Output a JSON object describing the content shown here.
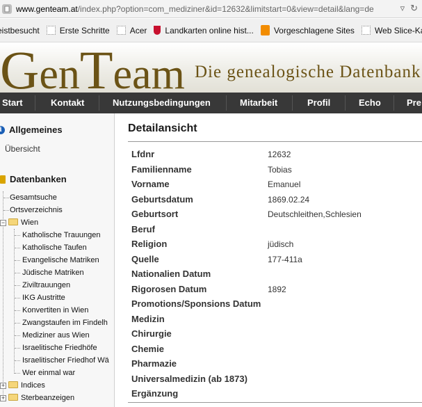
{
  "browser": {
    "url_host": "www.genteam.at",
    "url_rest": "/index.php?option=com_mediziner&id=12632&limitstart=0&view=detail&lang=de",
    "bookmarks": [
      "eistbesucht",
      "Erste Schritte",
      "Acer",
      "Landkarten online hist...",
      "Vorgeschlagene Sites",
      "Web Slice-Kata"
    ]
  },
  "banner": {
    "logo_g": "G",
    "logo_en": "en",
    "logo_t": "T",
    "logo_eam": "eam",
    "tagline": "Die genealogische Datenbank"
  },
  "nav": [
    "Start",
    "Kontakt",
    "Nutzungsbedingungen",
    "Mitarbeit",
    "Profil",
    "Echo",
    "Pre"
  ],
  "sidebar": {
    "allgemeines": "Allgemeines",
    "uebersicht": "Übersicht",
    "datenbanken": "Datenbanken",
    "tree": {
      "gesamtsuche": "Gesamtsuche",
      "ortsverzeichnis": "Ortsverzeichnis",
      "wien": "Wien",
      "wien_children": [
        "Katholische Trauungen",
        "Katholische Taufen",
        "Evangelische Matriken",
        "Jüdische Matriken",
        "Ziviltrauungen",
        "IKG Austritte",
        "Konvertiten in Wien",
        "Zwangstaufen im Findelh",
        "Mediziner aus Wien",
        "Israelitische Friedhöfe",
        "Israelitischer Friedhof Wä",
        "Wer einmal war"
      ],
      "indices": "Indices",
      "sterbeanzeigen": "Sterbeanzeigen"
    }
  },
  "detail": {
    "title": "Detailansicht",
    "rows": [
      {
        "label": "Lfdnr",
        "value": "12632"
      },
      {
        "label": "Familienname",
        "value": "Tobias"
      },
      {
        "label": "Vorname",
        "value": "Emanuel"
      },
      {
        "label": "Geburtsdatum",
        "value": "1869.02.24"
      },
      {
        "label": "Geburtsort",
        "value": "Deutschleithen,Schlesien"
      },
      {
        "label": "Beruf",
        "value": ""
      },
      {
        "label": "Religion",
        "value": "jüdisch"
      },
      {
        "label": "Quelle",
        "value": "177-411a"
      },
      {
        "label": "Nationalien Datum",
        "value": ""
      },
      {
        "label": "Rigorosen Datum",
        "value": "1892"
      },
      {
        "label": "Promotions/Sponsions Datum",
        "value": ""
      },
      {
        "label": "Medizin",
        "value": ""
      },
      {
        "label": "Chirurgie",
        "value": ""
      },
      {
        "label": "Chemie",
        "value": ""
      },
      {
        "label": "Pharmazie",
        "value": ""
      },
      {
        "label": "Universalmedizin (ab 1873)",
        "value": ""
      },
      {
        "label": "Ergänzung",
        "value": ""
      }
    ]
  },
  "icons": {
    "page": "page-icon",
    "info": "info-icon",
    "database": "database-icon",
    "folder": "folder-icon"
  }
}
